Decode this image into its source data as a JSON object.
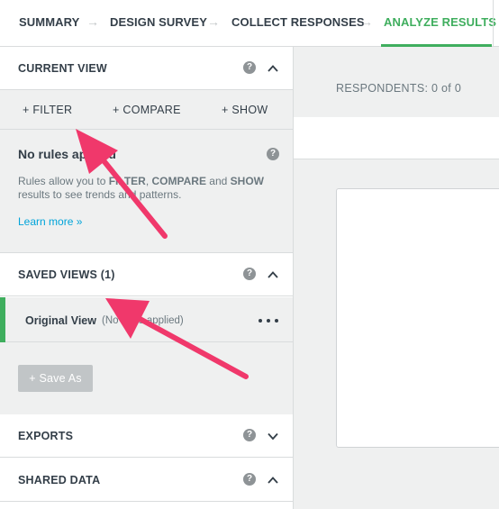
{
  "nav": {
    "items": [
      {
        "label": "SUMMARY"
      },
      {
        "label": "DESIGN SURVEY"
      },
      {
        "label": "COLLECT RESPONSES"
      },
      {
        "label": "ANALYZE RESULTS"
      }
    ],
    "arrow_glyph": "→",
    "active_color": "#3fae5e"
  },
  "current_view": {
    "title": "CURRENT VIEW",
    "help": "?",
    "filters": {
      "filter": "+ FILTER",
      "compare": "+ COMPARE",
      "show": "+ SHOW"
    },
    "rules_title": "No rules applied",
    "rules_desc_1": "Rules allow you to ",
    "rules_filter": "FILTER",
    "rules_sep_1": ", ",
    "rules_compare": "COMPARE",
    "rules_sep_2": " and ",
    "rules_show": "SHOW",
    "rules_desc_2": " results to see trends and patterns.",
    "learn_more": "Learn more »"
  },
  "saved_views": {
    "title": "SAVED VIEWS (1)",
    "help": "?",
    "view_name": "Original View",
    "view_sub": "(No rules applied)",
    "save_as": "+ Save As"
  },
  "exports": {
    "title": "EXPORTS",
    "help": "?"
  },
  "shared_data": {
    "title": "SHARED DATA",
    "help": "?"
  },
  "main": {
    "respondents": "RESPONDENTS: 0 of 0"
  },
  "colors": {
    "accent": "#3fae5e",
    "link": "#00a4d9",
    "annotation": "#f0386b"
  },
  "icons": [
    "help-icon",
    "chevron-up-icon",
    "chevron-down-icon",
    "more-dots-icon",
    "arrow-right-icon"
  ]
}
